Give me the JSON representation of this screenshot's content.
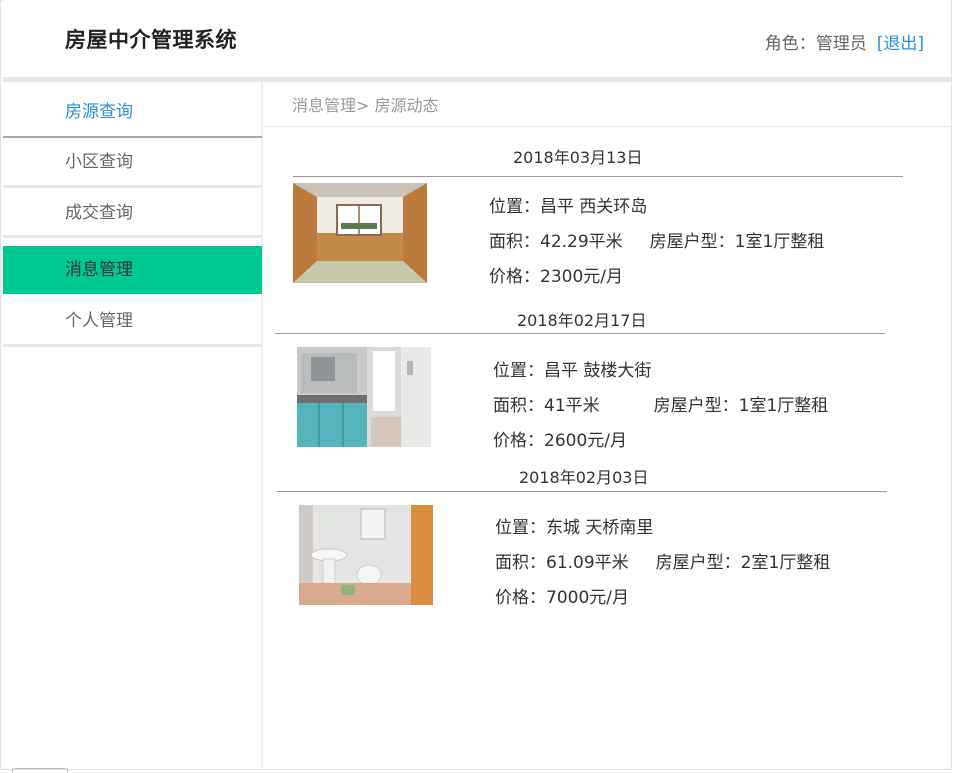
{
  "header": {
    "app_title": "房屋中介管理系统",
    "role_label": "角色：管理员",
    "logout_label": "[退出]"
  },
  "sidebar": {
    "items": [
      {
        "label": "房源查询"
      },
      {
        "label": "小区查询"
      },
      {
        "label": "成交查询"
      },
      {
        "label": "消息管理"
      },
      {
        "label": "个人管理"
      }
    ],
    "active_item": "消息管理",
    "active_color": "#00c893",
    "link_color": "#2a8fd6"
  },
  "breadcrumb": "消息管理> 房源动态",
  "listings": [
    {
      "date": "2018年03月13日",
      "location": "位置：昌平 西关环岛",
      "area_layout": "面积：42.29平米     房屋户型：1室1厅整租",
      "price": "价格：2300元/月",
      "photo": "room-photo"
    },
    {
      "date": "2018年02月17日",
      "location": "位置：昌平 鼓楼大街",
      "area_layout": "面积：41平米          房屋户型：1室1厅整租",
      "price": "价格：2600元/月",
      "photo": "kitchen-photo"
    },
    {
      "date": "2018年02月03日",
      "location": "位置：东城 天桥南里",
      "area_layout": "面积：61.09平米     房屋户型：2室1厅整租",
      "price": "价格：7000元/月",
      "photo": "bathroom-photo"
    }
  ]
}
